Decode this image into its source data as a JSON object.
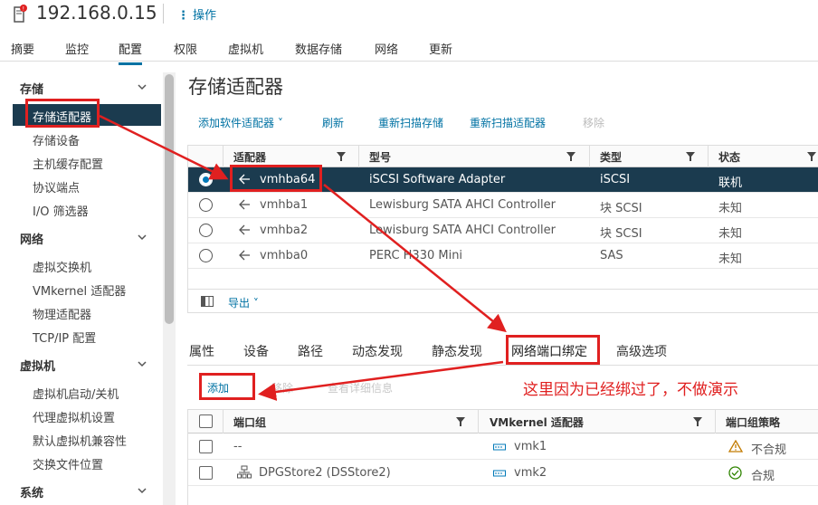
{
  "header": {
    "host": "192.168.0.15",
    "actions_label": "操作"
  },
  "top_tabs": [
    "摘要",
    "监控",
    "配置",
    "权限",
    "虚拟机",
    "数据存储",
    "网络",
    "更新"
  ],
  "active_top_tab": "配置",
  "sidebar": {
    "sections": [
      {
        "title": "存储",
        "items": [
          "存储适配器",
          "存储设备",
          "主机缓存配置",
          "协议端点",
          "I/O 筛选器"
        ]
      },
      {
        "title": "网络",
        "items": [
          "虚拟交换机",
          "VMkernel 适配器",
          "物理适配器",
          "TCP/IP 配置"
        ]
      },
      {
        "title": "虚拟机",
        "items": [
          "虚拟机启动/关机",
          "代理虚拟机设置",
          "默认虚拟机兼容性",
          "交换文件位置"
        ]
      },
      {
        "title": "系统",
        "items": []
      }
    ],
    "selected_item": "存储适配器"
  },
  "main": {
    "title": "存储适配器",
    "toolbar": {
      "add_software": "添加软件适配器",
      "refresh": "刷新",
      "rescan_storage": "重新扫描存储",
      "rescan_adapter": "重新扫描适配器",
      "remove": "移除"
    },
    "adapters_table": {
      "columns": [
        "适配器",
        "型号",
        "类型",
        "状态"
      ],
      "rows": [
        {
          "adapter": "vmhba64",
          "model": "iSCSI Software Adapter",
          "type": "iSCSI",
          "status": "联机",
          "selected": true
        },
        {
          "adapter": "vmhba1",
          "model": "Lewisburg SATA AHCI Controller",
          "type": "块 SCSI",
          "status": "未知",
          "selected": false
        },
        {
          "adapter": "vmhba2",
          "model": "Lewisburg SATA AHCI Controller",
          "type": "块 SCSI",
          "status": "未知",
          "selected": false
        },
        {
          "adapter": "vmhba0",
          "model": "PERC H330 Mini",
          "type": "SAS",
          "status": "未知",
          "selected": false
        }
      ],
      "export_label": "导出"
    },
    "detail_tabs": [
      "属性",
      "设备",
      "路径",
      "动态发现",
      "静态发现",
      "网络端口绑定",
      "高级选项"
    ],
    "active_detail_tab": "网络端口绑定",
    "binding_actions": {
      "add": "添加",
      "remove": "移除",
      "details": "查看详细信息"
    },
    "binding_table": {
      "columns": [
        "端口组",
        "VMkernel 适配器",
        "端口组策略"
      ],
      "rows": [
        {
          "port_group": "--",
          "vmkernel": "vmk1",
          "policy": "不合规",
          "policy_status": "warning"
        },
        {
          "port_group": "DPGStore2 (DSStore2)",
          "vmkernel": "vmk2",
          "policy": "合规",
          "policy_status": "ok"
        }
      ]
    }
  },
  "annotation": {
    "text": "这里因为已经绑过了，不做演示",
    "color": "#e02020"
  },
  "colors": {
    "accent": "#0072a3",
    "selected_row": "#1b3b4f",
    "warning": "#c27b00",
    "ok": "#2f8400"
  }
}
